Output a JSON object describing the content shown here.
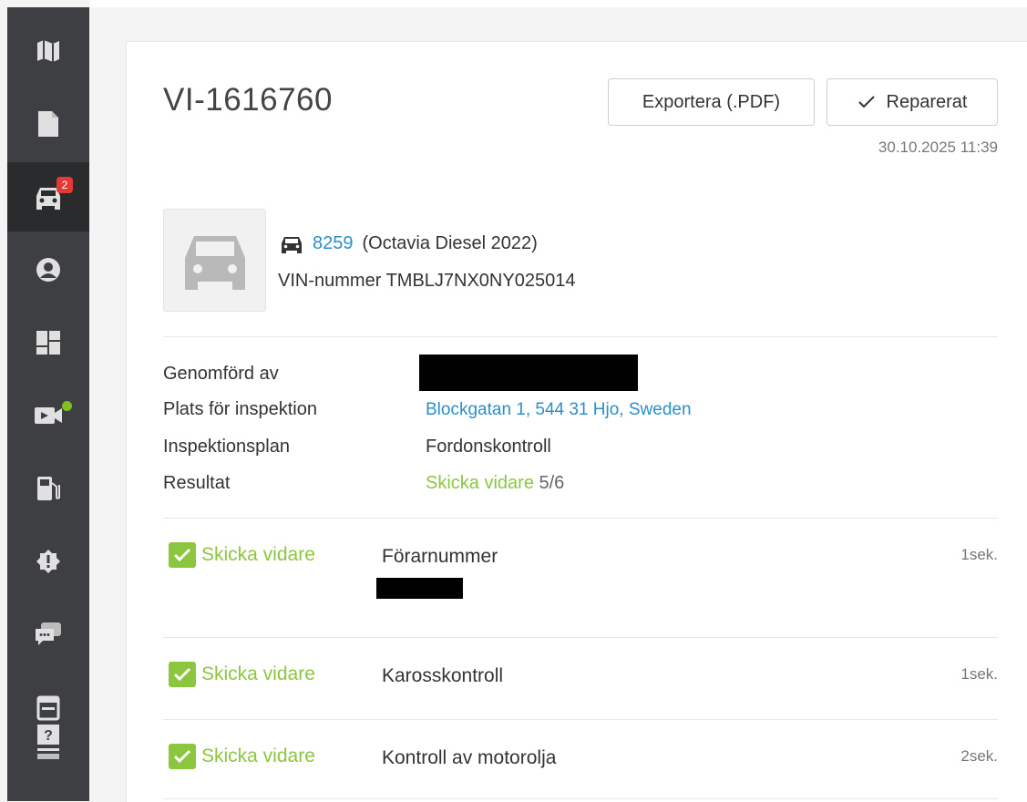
{
  "sidebar": {
    "items": [
      {
        "icon": "map-icon",
        "active": false
      },
      {
        "icon": "document-icon",
        "active": false
      },
      {
        "icon": "car-icon",
        "active": true,
        "badge": "2"
      },
      {
        "icon": "user-icon",
        "active": false
      },
      {
        "icon": "dashboard-icon",
        "active": false
      },
      {
        "icon": "camera-icon",
        "active": false,
        "status_dot_color": "#7dc21e"
      },
      {
        "icon": "fuel-icon",
        "active": false
      },
      {
        "icon": "alert-icon",
        "active": false
      },
      {
        "icon": "chat-icon",
        "active": false
      },
      {
        "icon": "calendar-icon",
        "active": false
      },
      {
        "icon": "help-icon",
        "active": false
      }
    ]
  },
  "header": {
    "title": "VI-1616760",
    "export_label": "Exportera (.PDF)",
    "repaired_label": "Reparerat",
    "timestamp": "30.10.2025 11:39"
  },
  "vehicle": {
    "number": "8259",
    "model": "(Octavia Diesel 2022)",
    "vin_label": "VIN-nummer",
    "vin": "TMBLJ7NX0NY025014"
  },
  "info": {
    "performed_by_label": "Genomförd av",
    "location_label": "Plats för inspektion",
    "location_value": "Blockgatan 1, 544 31 Hjo, Sweden",
    "plan_label": "Inspektionsplan",
    "plan_value": "Fordonskontroll",
    "result_label": "Resultat",
    "result_status": "Skicka vidare",
    "result_count": "5/6"
  },
  "checks": [
    {
      "status": "Skicka vidare",
      "name": "Förarnummer",
      "time": "1sek."
    },
    {
      "status": "Skicka vidare",
      "name": "Karosskontroll",
      "time": "1sek."
    },
    {
      "status": "Skicka vidare",
      "name": "Kontroll av motorolja",
      "time": "2sek."
    }
  ],
  "colors": {
    "sidebar_bg": "#3d3f42",
    "accent_green": "#8cc63f",
    "link_blue": "#2a8fc9",
    "badge_red": "#e53935"
  }
}
